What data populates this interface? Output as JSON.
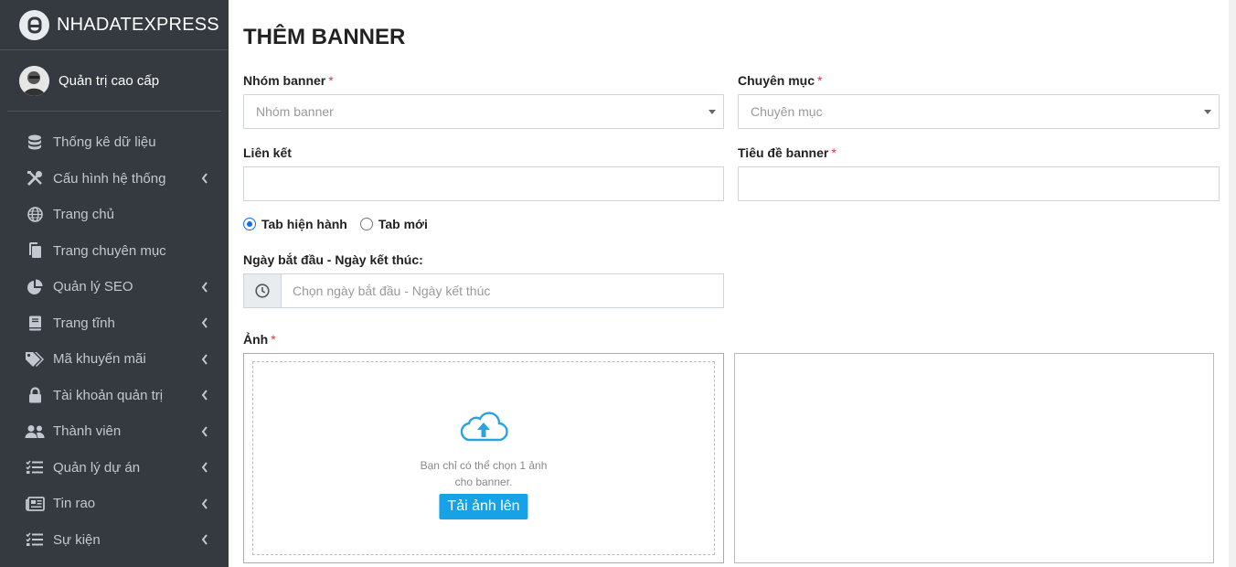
{
  "brand": {
    "name": "NHADATEXPRESS"
  },
  "user": {
    "name": "Quản trị cao cấp"
  },
  "sidebar": {
    "items": [
      {
        "label": "Thống kê dữ liệu",
        "icon": "database-icon",
        "has_chevron": false
      },
      {
        "label": "Cấu hình hệ thống",
        "icon": "tools-icon",
        "has_chevron": true
      },
      {
        "label": "Trang chủ",
        "icon": "globe-icon",
        "has_chevron": false
      },
      {
        "label": "Trang chuyên mục",
        "icon": "copy-icon",
        "has_chevron": false
      },
      {
        "label": "Quản lý SEO",
        "icon": "pie-chart-icon",
        "has_chevron": true
      },
      {
        "label": "Trang tĩnh",
        "icon": "book-icon",
        "has_chevron": true
      },
      {
        "label": "Mã khuyến mãi",
        "icon": "tags-icon",
        "has_chevron": true
      },
      {
        "label": "Tài khoản quản trị",
        "icon": "lock-icon",
        "has_chevron": true
      },
      {
        "label": "Thành viên",
        "icon": "users-icon",
        "has_chevron": true
      },
      {
        "label": "Quản lý dự án",
        "icon": "tasks-icon",
        "has_chevron": true
      },
      {
        "label": "Tin rao",
        "icon": "newspaper-icon",
        "has_chevron": true
      },
      {
        "label": "Sự kiện",
        "icon": "tasks-icon",
        "has_chevron": true
      }
    ]
  },
  "page": {
    "title": "THÊM BANNER"
  },
  "form": {
    "group": {
      "label": "Nhóm banner",
      "required_mark": "*",
      "placeholder": "Nhóm banner"
    },
    "category": {
      "label": "Chuyên mục",
      "required_mark": "*",
      "placeholder": "Chuyên mục"
    },
    "link": {
      "label": "Liên kết",
      "value": ""
    },
    "banner_title": {
      "label": "Tiêu đề banner",
      "required_mark": "*",
      "value": ""
    },
    "target": {
      "options": [
        {
          "label": "Tab hiện hành",
          "checked": true
        },
        {
          "label": "Tab mới",
          "checked": false
        }
      ]
    },
    "date_range": {
      "label": "Ngày bắt đầu - Ngày kết thúc:",
      "placeholder": "Chọn ngày bắt đầu - Ngày kết thúc"
    },
    "image": {
      "label": "Ảnh",
      "required_mark": "*",
      "help_line1": "Bạn chỉ có thể chọn 1 ảnh",
      "help_line2": "cho banner.",
      "button_label": "Tải ảnh lên"
    }
  },
  "colors": {
    "sidebar_bg": "#343a40",
    "accent": "#17a2e8",
    "radio_checked": "#0d6efd",
    "required": "#dc3545"
  }
}
